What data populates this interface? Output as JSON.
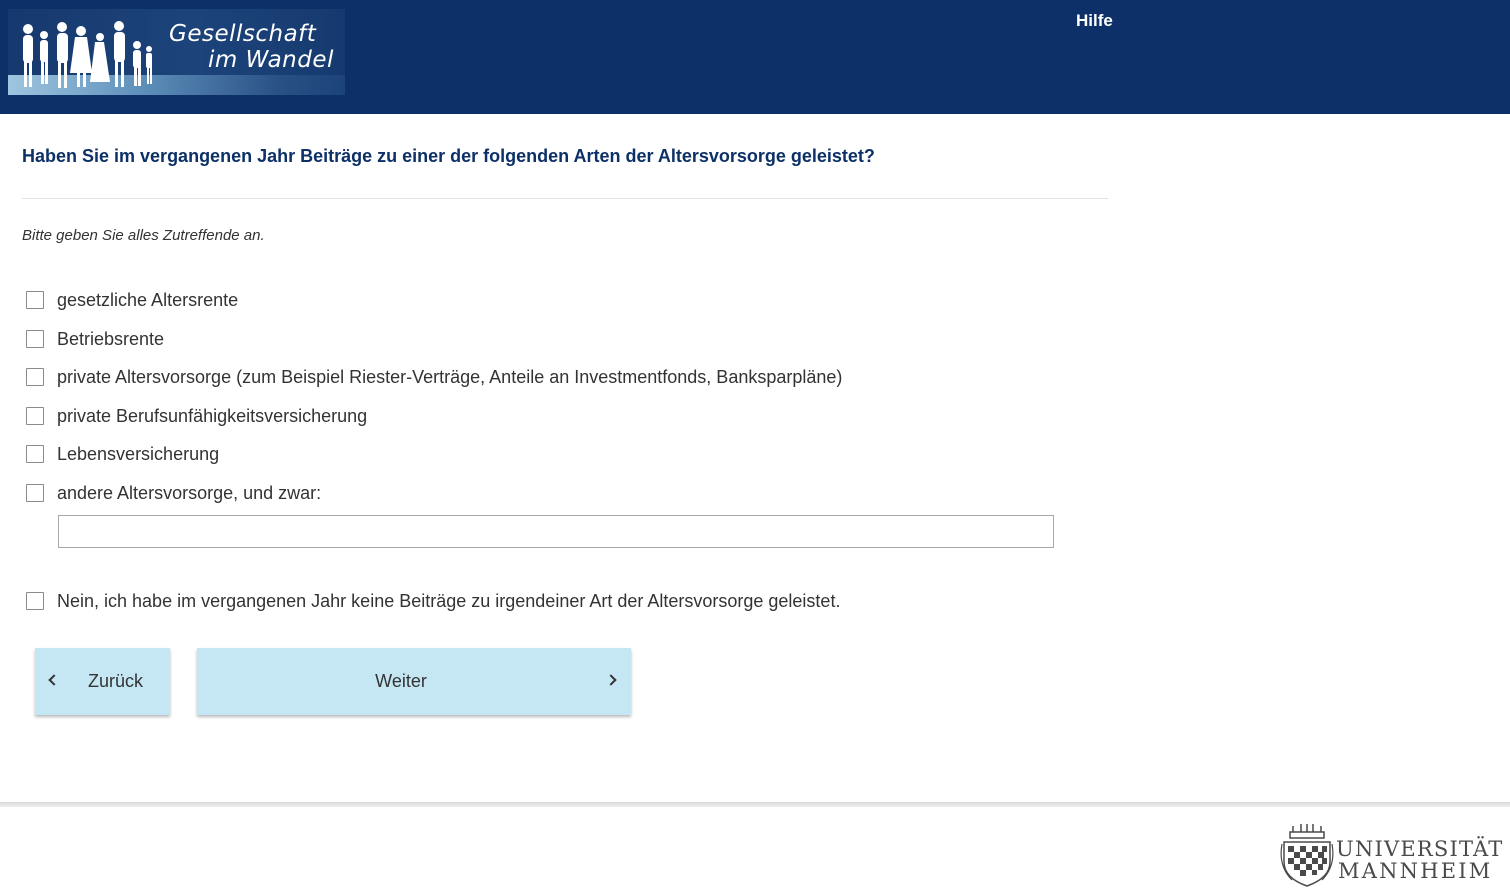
{
  "header": {
    "logo_line1": "Gesellschaft",
    "logo_line2": "im Wandel",
    "help_label": "Hilfe"
  },
  "question": {
    "title": "Haben Sie im vergangenen Jahr Beiträge zu einer der folgenden Arten der Altersvorsorge geleistet?",
    "instruction": "Bitte geben Sie alles Zutreffende an."
  },
  "options": [
    {
      "label": "gesetzliche Altersrente",
      "checked": false
    },
    {
      "label": "Betriebsrente",
      "checked": false
    },
    {
      "label": "private Altersvorsorge (zum Beispiel Riester-Verträge, Anteile an Investmentfonds, Banksparpläne)",
      "checked": false
    },
    {
      "label": "private Berufsunfähigkeitsversicherung",
      "checked": false
    },
    {
      "label": "Lebensversicherung",
      "checked": false
    },
    {
      "label": "andere Altersvorsorge, und zwar:",
      "checked": false
    },
    {
      "label": "Nein, ich habe im vergangenen Jahr keine Beiträge zu irgendeiner Art der Altersvorsorge geleistet.",
      "checked": false
    }
  ],
  "other_input": {
    "value": "",
    "placeholder": ""
  },
  "nav": {
    "back_label": "Zurück",
    "next_label": "Weiter"
  },
  "footer": {
    "uni_line1": "UNIVERSITÄT",
    "uni_line2": "MANNHEIM"
  },
  "colors": {
    "header_bg": "#0c3067",
    "question_color": "#0c3067",
    "button_bg": "#c5e6f3"
  },
  "icons": [
    "people-silhouette-icon",
    "chevron-left-icon",
    "chevron-right-icon",
    "university-crest-icon"
  ]
}
